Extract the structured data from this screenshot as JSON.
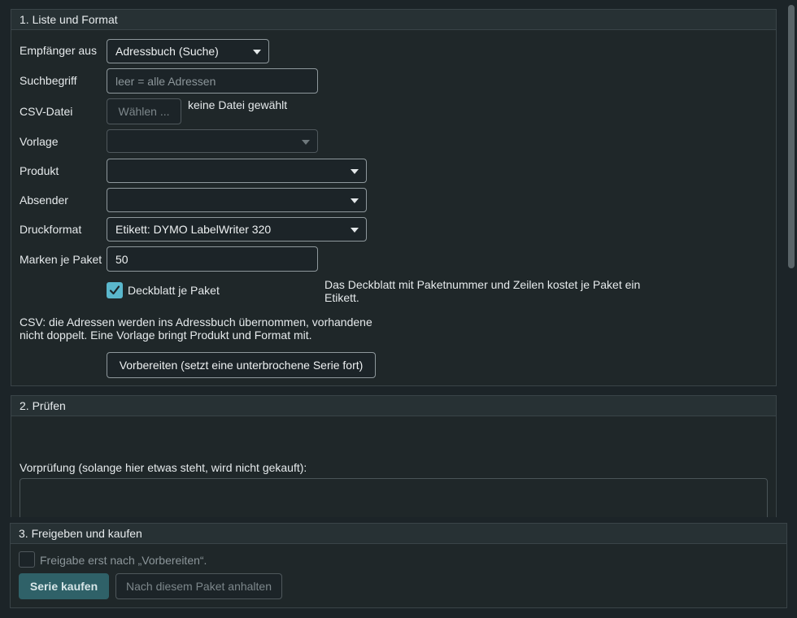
{
  "section1": {
    "title": "1. Liste und Format",
    "recipient": {
      "label": "Empfänger aus",
      "value": "Adressbuch (Suche)"
    },
    "search": {
      "label": "Suchbegriff",
      "placeholder": "leer = alle Adressen"
    },
    "csv": {
      "label": "CSV-Datei",
      "button": "Wählen ...",
      "status": "keine Datei gewählt"
    },
    "template": {
      "label": "Vorlage",
      "value": ""
    },
    "product": {
      "label": "Produkt",
      "value": ""
    },
    "sender": {
      "label": "Absender",
      "value": ""
    },
    "print_format": {
      "label": "Druckformat",
      "value": "Etikett: DYMO LabelWriter 320"
    },
    "stamps_per_packet": {
      "label": "Marken je Paket",
      "value": "50"
    },
    "cover_sheet": {
      "label": "Deckblatt je Paket",
      "checked": true,
      "hint": "Das Deckblatt mit Paketnummer und Zeilen kostet je Paket ein Etikett."
    },
    "csv_note": "CSV: die Adressen werden ins Adressbuch übernommen, vorhandene nicht doppelt. Eine Vorlage bringt Produkt und Format mit.",
    "prepare_button": "Vorbereiten (setzt eine unterbrochene Serie fort)"
  },
  "section2": {
    "title": "2. Prüfen",
    "precheck_label": "Vorprüfung (solange hier etwas steht, wird nicht gekauft):",
    "precheck_text": ""
  },
  "section3": {
    "title": "3. Freigeben und kaufen",
    "release_label": "Freigabe erst nach „Vorbereiten“.",
    "release_checked": false,
    "buy_button": "Serie kaufen",
    "pause_button": "Nach diesem Paket anhalten"
  },
  "colors": {
    "accent": "#5ab7cc",
    "primary_button": "#2f6168",
    "background": "#1c2428"
  }
}
